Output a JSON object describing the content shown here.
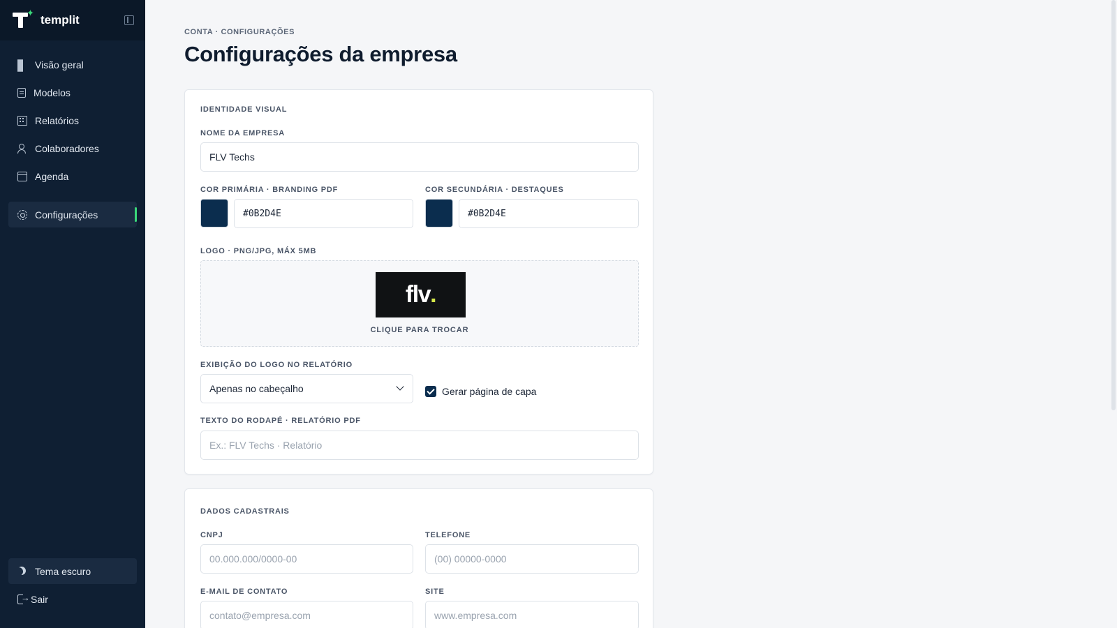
{
  "app": {
    "name": "templit",
    "accent": "#3ad87a",
    "sidebar_bg": "#0f1f33"
  },
  "sidebar": {
    "items": [
      {
        "label": "Visão geral",
        "icon": "grid-icon"
      },
      {
        "label": "Modelos",
        "icon": "document-icon"
      },
      {
        "label": "Relatórios",
        "icon": "building-icon"
      },
      {
        "label": "Colaboradores",
        "icon": "users-icon"
      },
      {
        "label": "Agenda",
        "icon": "calendar-icon"
      }
    ],
    "active": {
      "label": "Configurações",
      "icon": "gear-icon"
    },
    "bottom": [
      {
        "label": "Tema escuro",
        "icon": "moon-icon"
      },
      {
        "label": "Sair",
        "icon": "logout-icon"
      }
    ]
  },
  "page": {
    "breadcrumb": "CONTA · CONFIGURAÇÕES",
    "title": "Configurações da empresa"
  },
  "identity": {
    "section_title": "IDENTIDADE VISUAL",
    "company_name_label": "NOME DA EMPRESA",
    "company_name_value": "FLV Techs",
    "primary_color_label": "COR PRIMÁRIA · BRANDING PDF",
    "primary_color_value": "#0B2D4E",
    "secondary_color_label": "COR SECUNDÁRIA · DESTAQUES",
    "secondary_color_value": "#0B2D4E",
    "logo_label": "LOGO · PNG/JPG, MÁX 5MB",
    "logo_text": "flv",
    "logo_dot": ".",
    "logo_caption": "CLIQUE PARA TROCAR",
    "logo_display_label": "EXIBIÇÃO DO LOGO NO RELATÓRIO",
    "logo_display_value": "Apenas no cabeçalho",
    "cover_page_label": "Gerar página de capa",
    "cover_page_checked": true,
    "footer_label": "TEXTO DO RODAPÉ · RELATÓRIO PDF",
    "footer_placeholder": "Ex.: FLV Techs · Relatório"
  },
  "registration": {
    "section_title": "DADOS CADASTRAIS",
    "cnpj_label": "CNPJ",
    "cnpj_placeholder": "00.000.000/0000-00",
    "phone_label": "TELEFONE",
    "phone_placeholder": "(00) 00000-0000",
    "email_label": "E-MAIL DE CONTATO",
    "email_placeholder": "contato@empresa.com",
    "site_label": "SITE",
    "site_placeholder": "www.empresa.com"
  }
}
